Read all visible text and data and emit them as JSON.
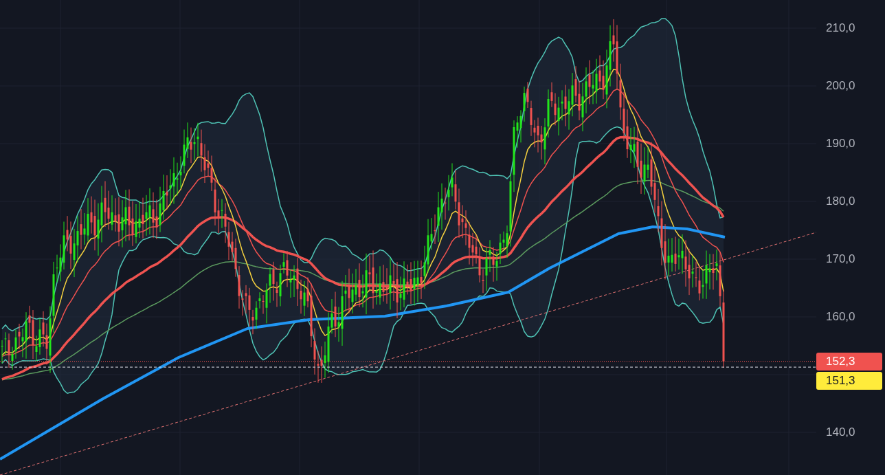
{
  "price_axis": {
    "ticks": [
      "210,0",
      "200,0",
      "190,0",
      "180,0",
      "170,0",
      "160,0",
      "140,0"
    ]
  },
  "price_badges": [
    {
      "text": "152,3",
      "color": "#f0524f"
    },
    {
      "text": "151,3",
      "color": "#ffeb3b"
    }
  ]
}
